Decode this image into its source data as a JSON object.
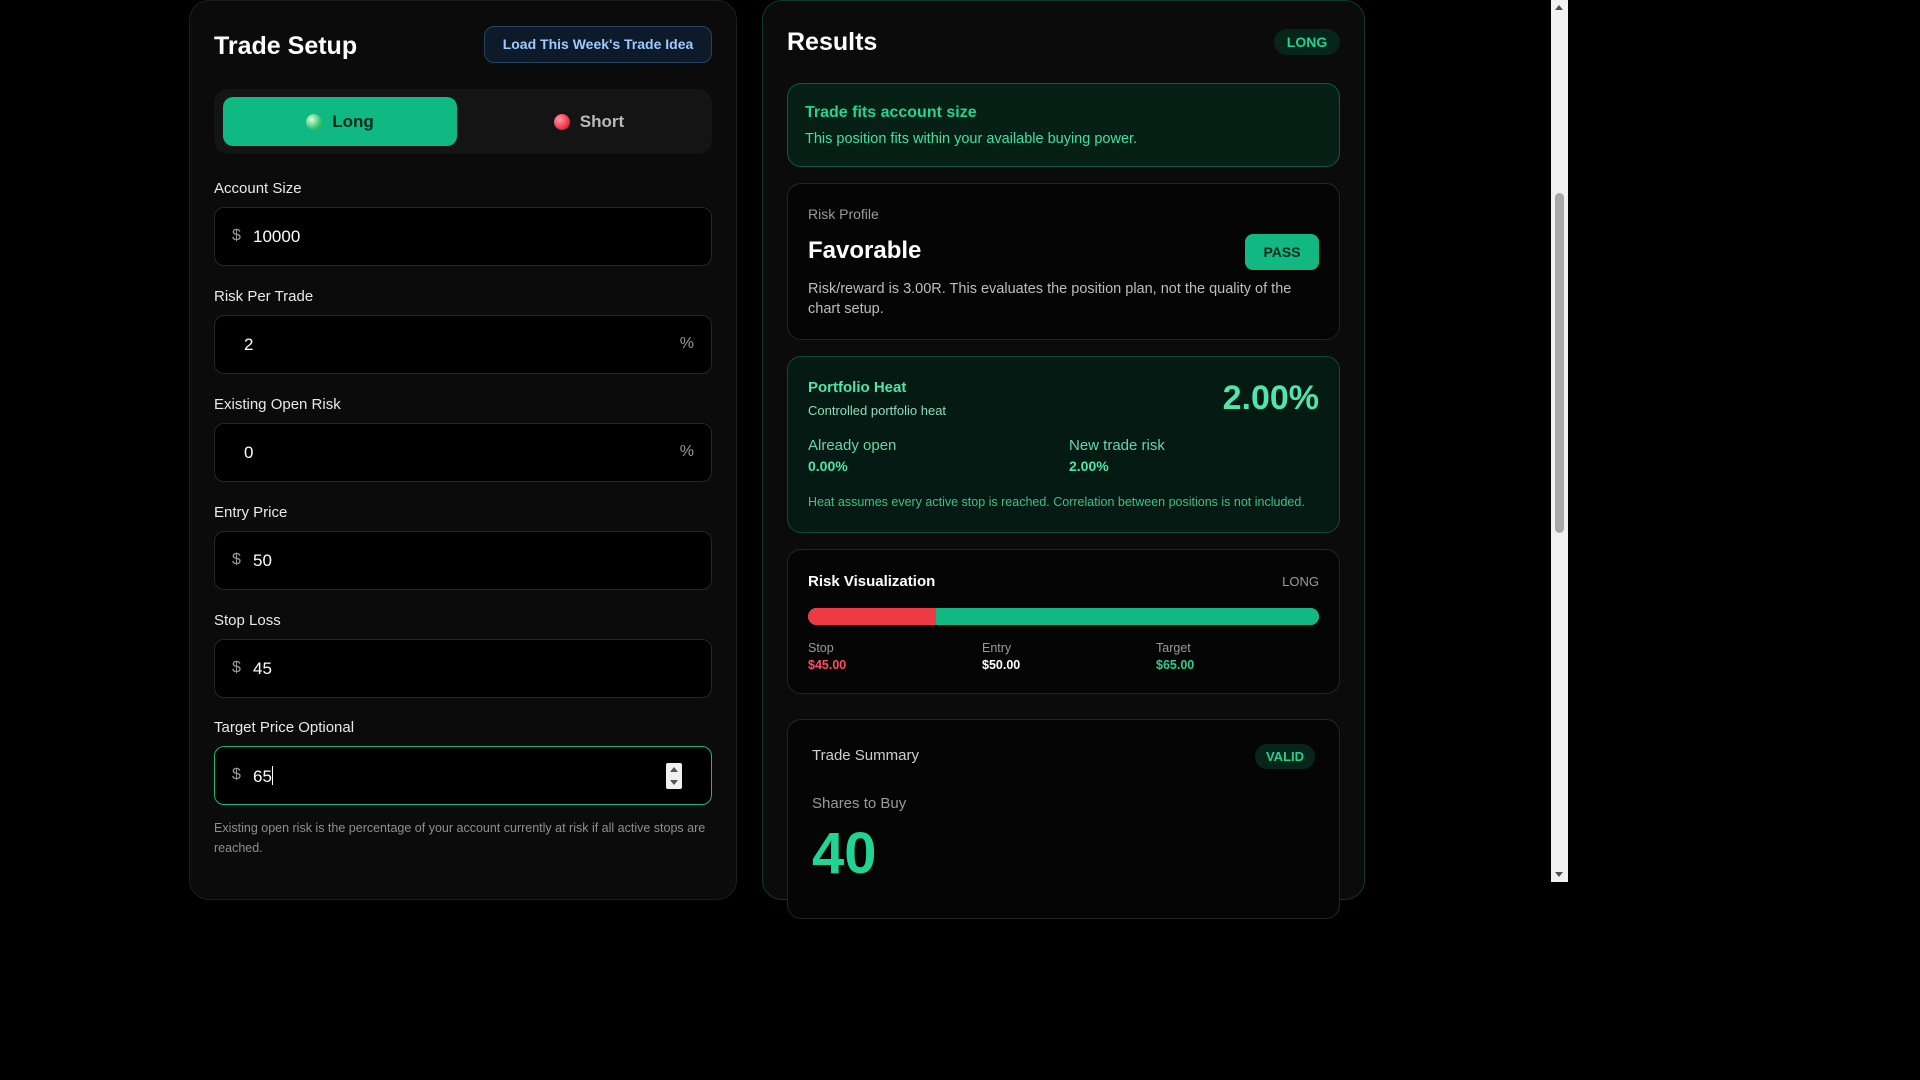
{
  "colors": {
    "accent_green": "#0fb981",
    "danger_red": "#ef3a46",
    "link_blue": "#9ecbff",
    "background": "#000000"
  },
  "setup": {
    "title": "Trade Setup",
    "load_button": "Load This Week's Trade Idea",
    "direction": {
      "selected": "Long",
      "long_label": "Long",
      "short_label": "Short"
    },
    "fields": {
      "account_size": {
        "label": "Account Size",
        "prefix": "$",
        "value": "10000"
      },
      "risk_per_trade": {
        "label": "Risk Per Trade",
        "suffix": "%",
        "value": "2"
      },
      "existing_open_risk": {
        "label": "Existing Open Risk",
        "suffix": "%",
        "value": "0"
      },
      "entry_price": {
        "label": "Entry Price",
        "prefix": "$",
        "value": "50"
      },
      "stop_loss": {
        "label": "Stop Loss",
        "prefix": "$",
        "value": "45"
      },
      "target_price": {
        "label": "Target Price Optional",
        "prefix": "$",
        "value": "65"
      }
    },
    "helper_text": "Existing open risk is the percentage of your account currently at risk if all active stops are reached."
  },
  "results": {
    "title": "Results",
    "direction_badge": "LONG",
    "fit": {
      "title": "Trade fits account size",
      "text": "This position fits within your available buying power."
    },
    "risk_profile": {
      "label": "Risk Profile",
      "rating": "Favorable",
      "badge": "PASS",
      "text": "Risk/reward is 3.00R. This evaluates the position plan, not the quality of the chart setup."
    },
    "portfolio_heat": {
      "title": "Portfolio Heat",
      "subtitle": "Controlled portfolio heat",
      "total": "2.00%",
      "already_open_label": "Already open",
      "already_open_value": "0.00%",
      "new_trade_label": "New trade risk",
      "new_trade_value": "2.00%",
      "note": "Heat assumes every active stop is reached. Correlation between positions is not included."
    },
    "risk_visualization": {
      "title": "Risk Visualization",
      "direction": "LONG",
      "stop_label": "Stop",
      "stop_value": "$45.00",
      "entry_label": "Entry",
      "entry_value": "$50.00",
      "target_label": "Target",
      "target_value": "$65.00",
      "stop": 45,
      "entry": 50,
      "target": 65
    },
    "summary": {
      "title": "Trade Summary",
      "badge": "VALID",
      "shares_label": "Shares to Buy",
      "shares_value": "40"
    }
  }
}
